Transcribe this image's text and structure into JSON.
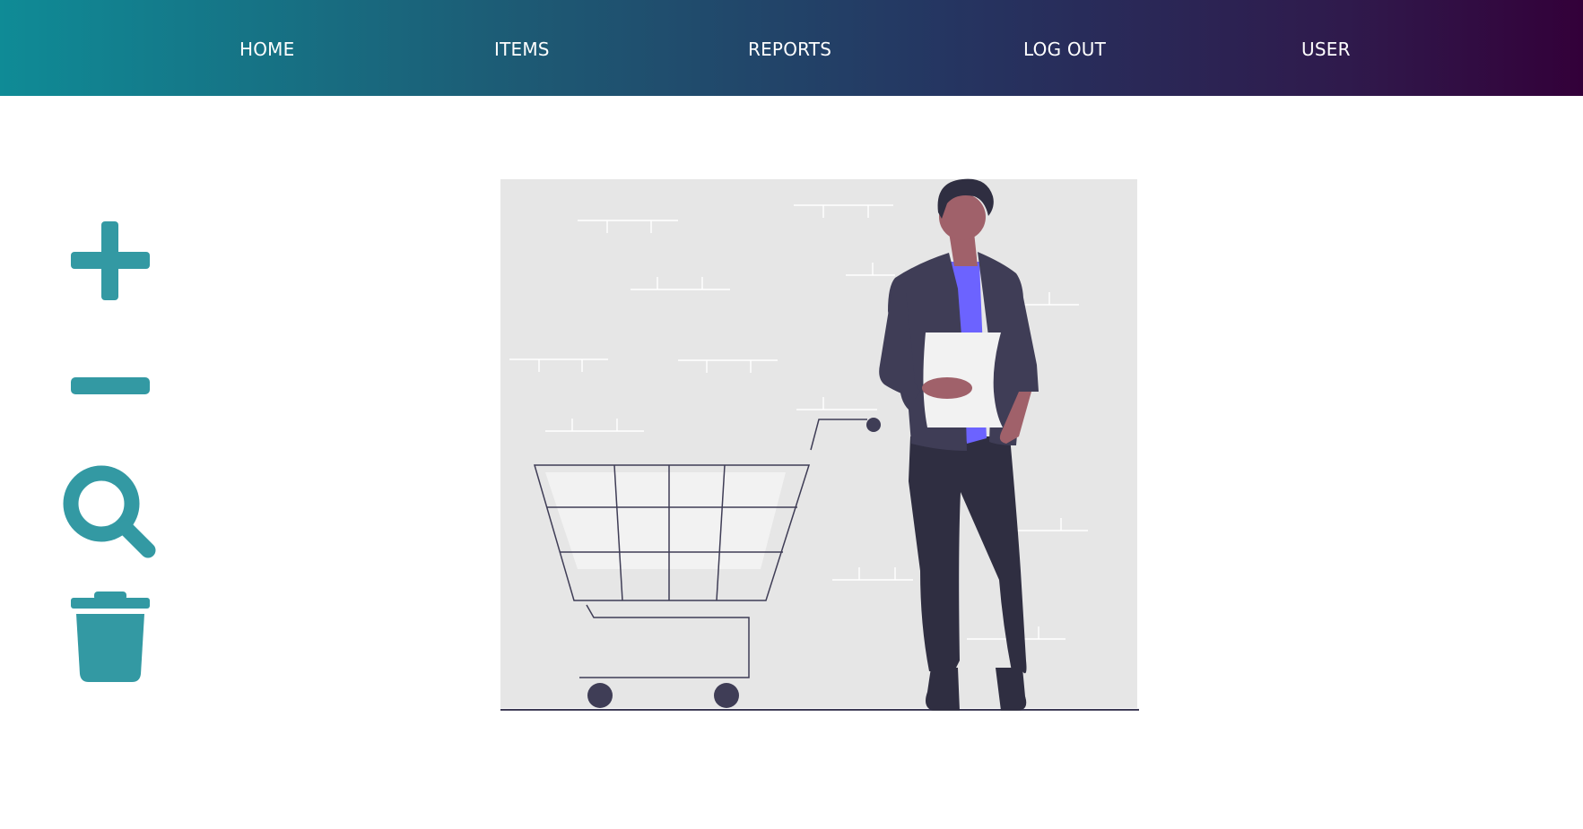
{
  "nav": {
    "items": [
      {
        "label": "HOME"
      },
      {
        "label": "ITEMS"
      },
      {
        "label": "REPORTS"
      },
      {
        "label": "LOG OUT"
      },
      {
        "label": "USER"
      }
    ]
  },
  "toolbar": {
    "icons": [
      "plus-icon",
      "minus-icon",
      "search-icon",
      "trash-icon"
    ],
    "accent_color": "#3399a3"
  },
  "illustration": {
    "subject": "person holding a list next to a shopping cart"
  },
  "colors": {
    "nav_gradient_start": "#0f8b96",
    "nav_gradient_end": "#330039",
    "background": "#ffffff",
    "illustration_bg": "#e6e6e6",
    "figure_dark": "#3f3d56",
    "figure_accent": "#6c63ff"
  }
}
